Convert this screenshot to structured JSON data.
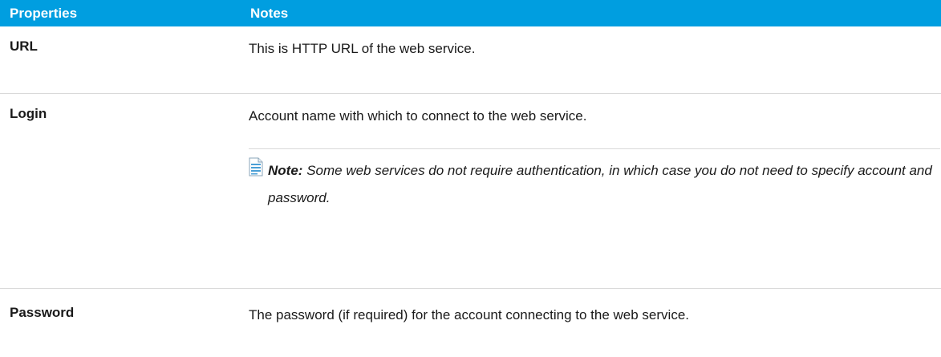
{
  "table": {
    "headers": {
      "properties": "Properties",
      "notes": "Notes"
    },
    "rows": [
      {
        "property": "URL",
        "note": "This is HTTP URL of the web service."
      },
      {
        "property": "Login",
        "note": "Account name with which to connect to the web service.",
        "callout": {
          "icon": "note-page-icon",
          "label": "Note:",
          "text": "Some web services do not require authentication, in which case you do not need to specify account and password."
        }
      },
      {
        "property": "Password",
        "note": "The password (if required) for the account connecting to the web service."
      }
    ]
  },
  "colors": {
    "header_bg": "#009ee0",
    "header_text": "#ffffff",
    "rule": "#d9d9d9"
  }
}
